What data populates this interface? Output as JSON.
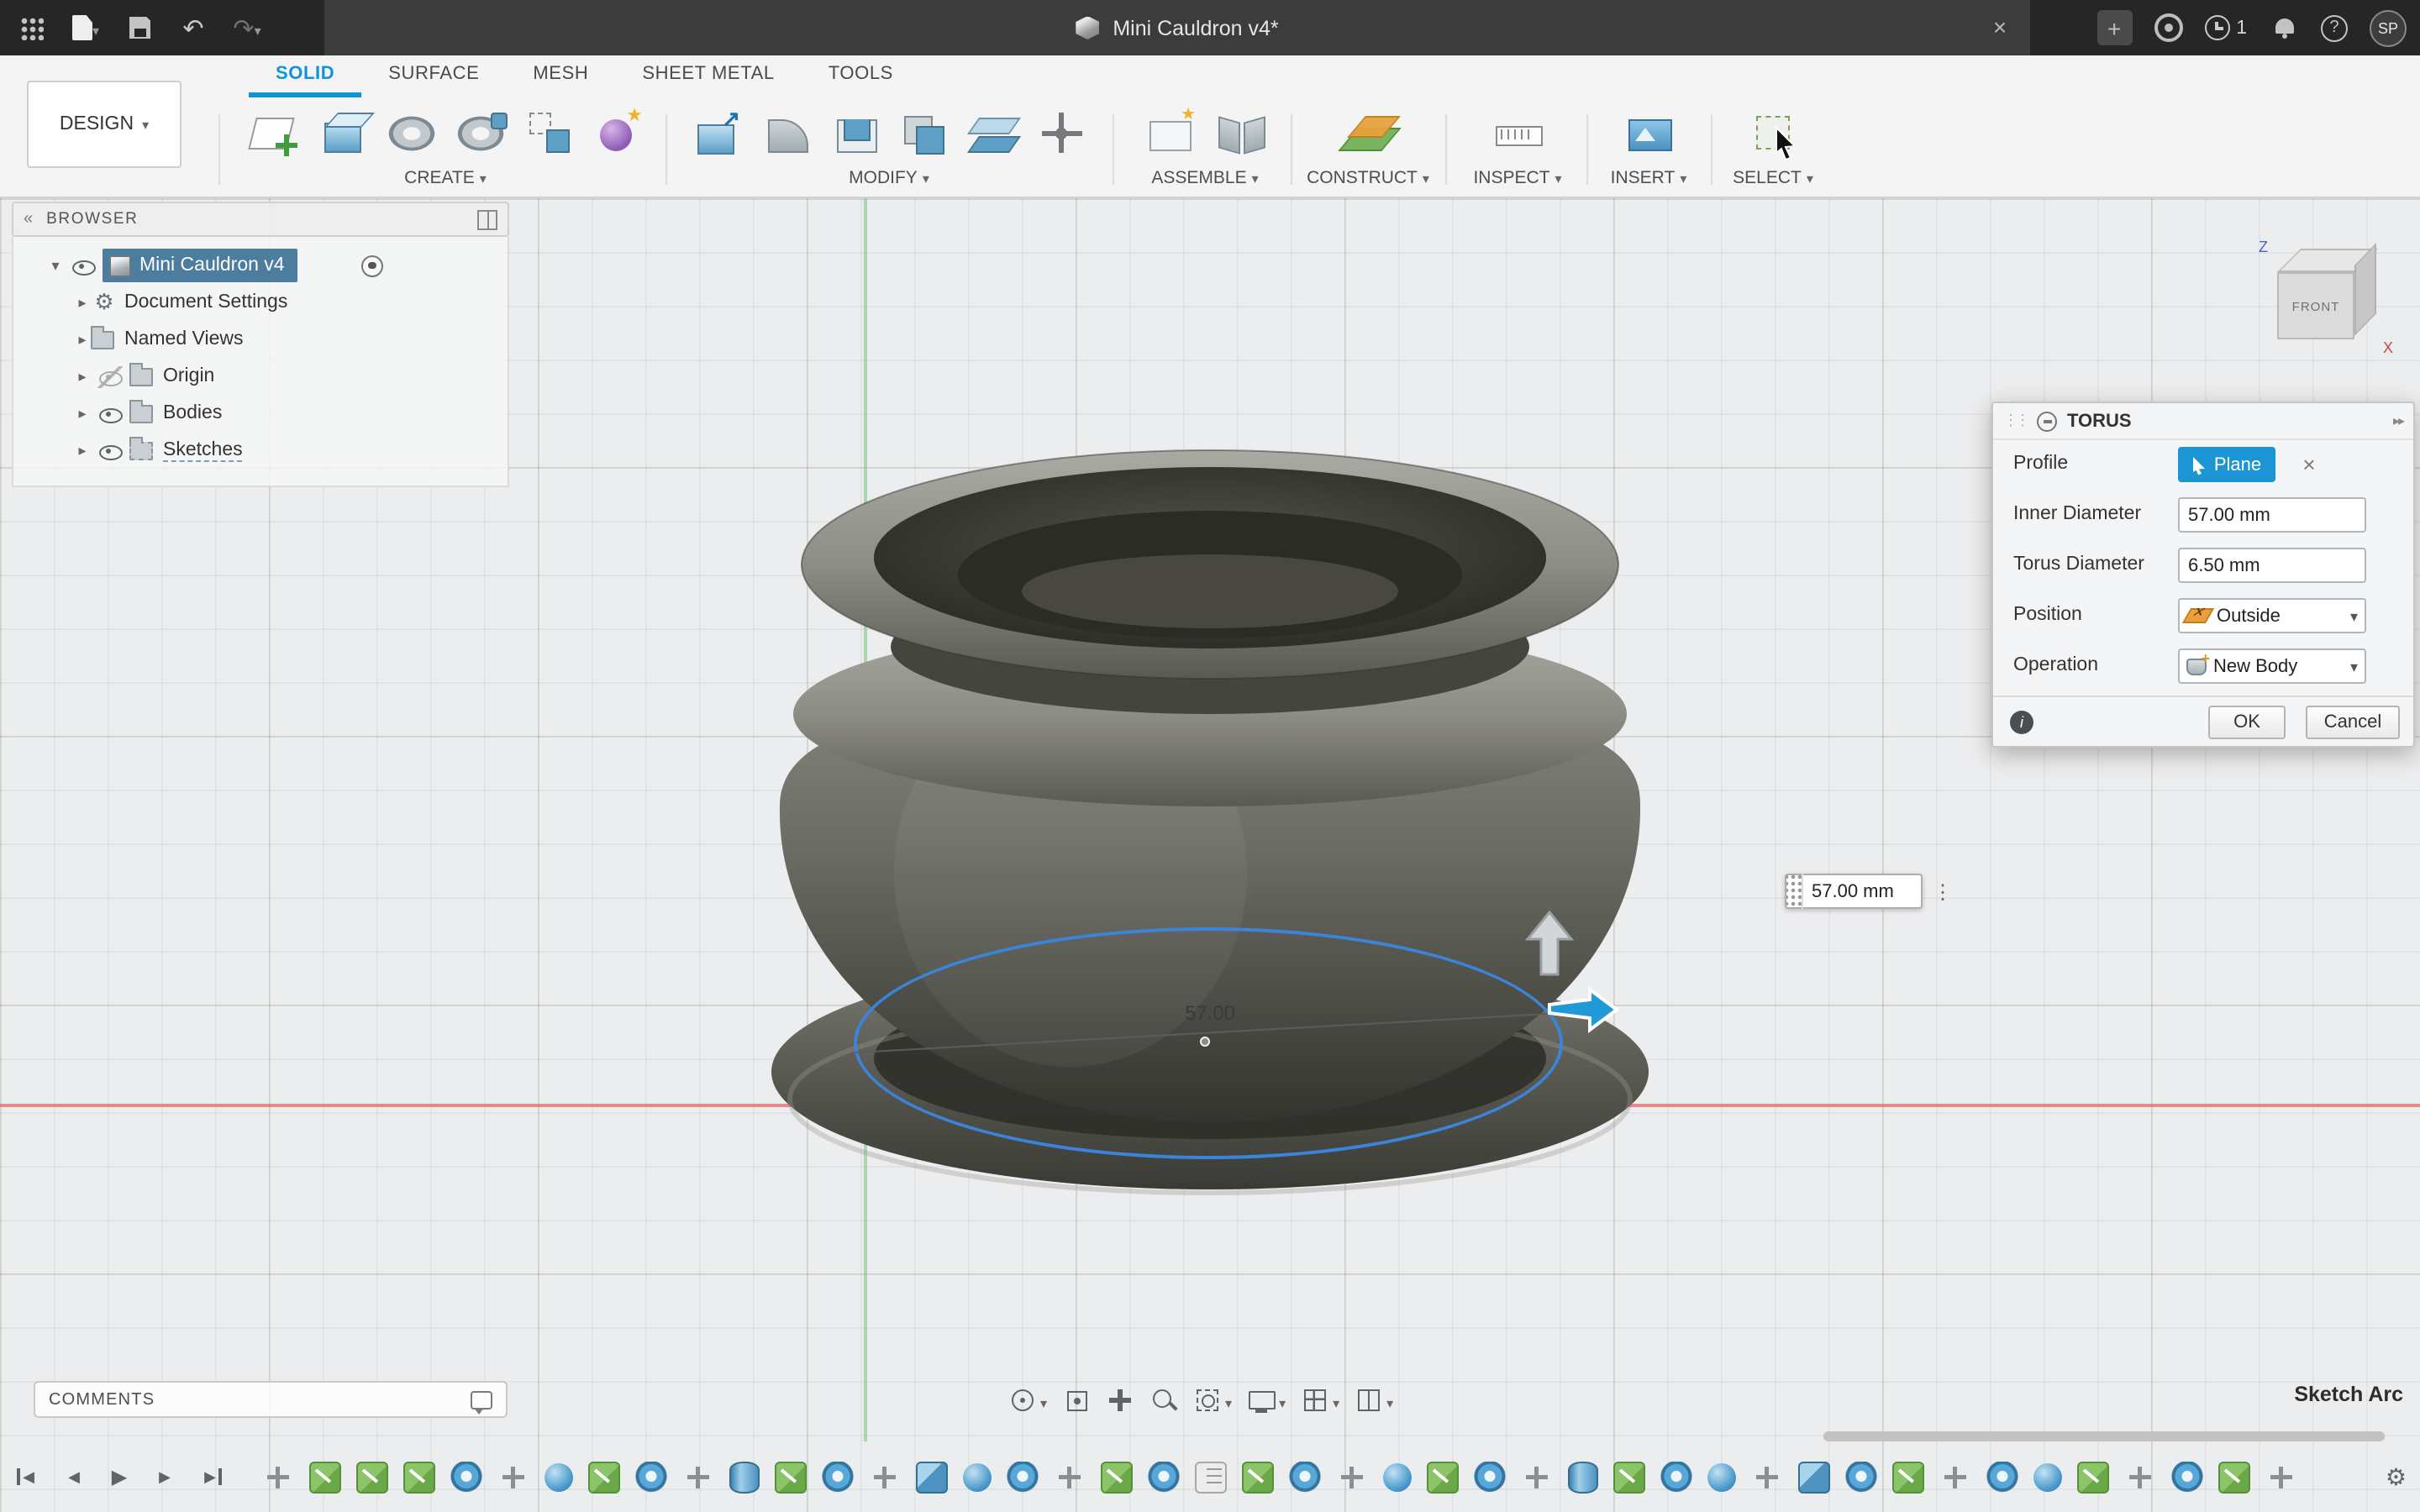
{
  "titlebar": {
    "title": "Mini Cauldron v4*",
    "notification_count": "1",
    "user_initials": "SP"
  },
  "ribbon": {
    "workspace": "DESIGN",
    "tabs": [
      {
        "label": "SOLID",
        "active": true
      },
      {
        "label": "SURFACE",
        "active": false
      },
      {
        "label": "MESH",
        "active": false
      },
      {
        "label": "SHEET METAL",
        "active": false
      },
      {
        "label": "TOOLS",
        "active": false
      }
    ],
    "groups": [
      {
        "label": "CREATE",
        "icons": [
          "create-sketch",
          "box",
          "revolve",
          "sweep",
          "pattern",
          "create-form"
        ]
      },
      {
        "label": "MODIFY",
        "icons": [
          "press-pull",
          "fillet",
          "shell",
          "combine",
          "split-body",
          "move-copy"
        ]
      },
      {
        "label": "ASSEMBLE",
        "icons": [
          "new-component",
          "joint"
        ]
      },
      {
        "label": "CONSTRUCT",
        "icons": [
          "construction-plane"
        ]
      },
      {
        "label": "INSPECT",
        "icons": [
          "measure"
        ]
      },
      {
        "label": "INSERT",
        "icons": [
          "insert-canvas"
        ]
      },
      {
        "label": "SELECT",
        "icons": [
          "select-window"
        ]
      }
    ]
  },
  "browser": {
    "title": "BROWSER",
    "root_label": "Mini Cauldron v4",
    "items": [
      {
        "label": "Document Settings",
        "icon": "gear",
        "eye": "none"
      },
      {
        "label": "Named Views",
        "icon": "folder",
        "eye": "none"
      },
      {
        "label": "Origin",
        "icon": "folder",
        "eye": "off"
      },
      {
        "label": "Bodies",
        "icon": "folder",
        "eye": "on"
      },
      {
        "label": "Sketches",
        "icon": "folder-dashed",
        "eye": "on"
      }
    ]
  },
  "viewcube": {
    "front_label": "FRONT",
    "z_label": "Z",
    "x_label": "X"
  },
  "torus_dialog": {
    "title": "TORUS",
    "profile_label": "Profile",
    "profile_value": "Plane",
    "inner_diameter_label": "Inner Diameter",
    "inner_diameter_value": "57.00 mm",
    "torus_diameter_label": "Torus Diameter",
    "torus_diameter_value": "6.50 mm",
    "position_label": "Position",
    "position_value": "Outside",
    "operation_label": "Operation",
    "operation_value": "New Body",
    "ok_label": "OK",
    "cancel_label": "Cancel"
  },
  "viewport": {
    "dimension_value": "57.00",
    "dim_input_value": "57.00 mm"
  },
  "comments": {
    "label": "COMMENTS"
  },
  "statusbar": {
    "active_tool": "Sketch Arc"
  },
  "nav_toolbar": {
    "icons": [
      {
        "name": "orbit",
        "caret": true
      },
      {
        "name": "look-at",
        "caret": false
      },
      {
        "name": "pan",
        "caret": false
      },
      {
        "name": "zoom",
        "caret": false
      },
      {
        "name": "zoom-window",
        "caret": true
      },
      {
        "name": "display-settings",
        "caret": true
      },
      {
        "name": "layout-grid",
        "caret": true
      },
      {
        "name": "multiple-views",
        "caret": true
      }
    ]
  },
  "timeline": {
    "icons": [
      "move",
      "sketch",
      "sketch",
      "sketch",
      "torus",
      "move",
      "sphere",
      "sketch",
      "torus",
      "move",
      "cylinder",
      "sketch",
      "torus",
      "move",
      "box",
      "sphere",
      "torus",
      "move",
      "sketch",
      "torus",
      "doc",
      "sketch",
      "torus",
      "move",
      "sphere",
      "sketch",
      "torus",
      "move",
      "cylinder",
      "sketch",
      "torus",
      "sphere",
      "move",
      "box",
      "torus",
      "sketch",
      "move",
      "torus",
      "sphere",
      "sketch",
      "move",
      "torus",
      "sketch",
      "move"
    ]
  }
}
